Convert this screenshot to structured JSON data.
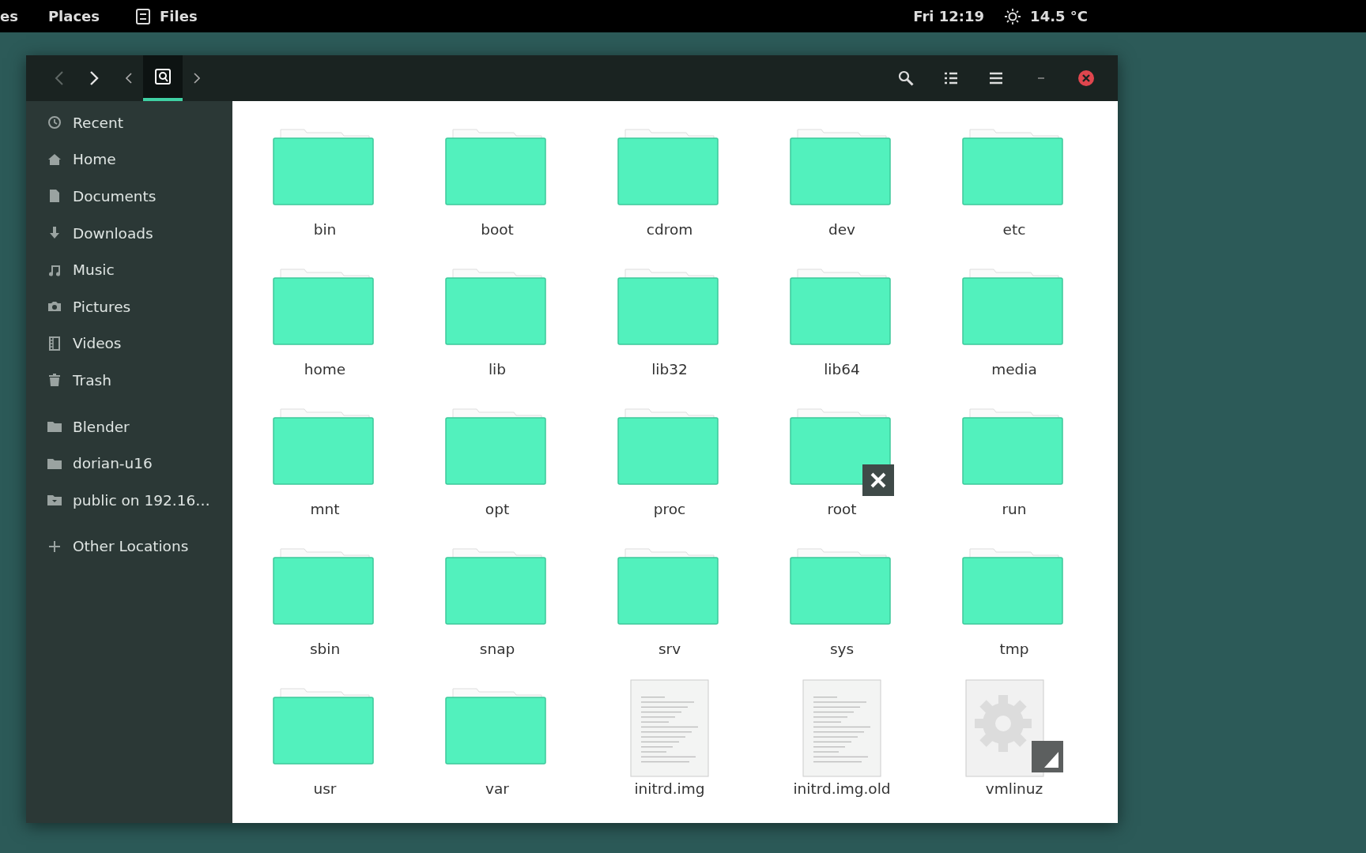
{
  "top_bar": {
    "activities": "es",
    "places": "Places",
    "app": "Files",
    "clock": "Fri 12:19",
    "weather": "14.5 °C"
  },
  "header": {
    "back_disabled": true,
    "forward_disabled": false,
    "path": [
      {
        "kind": "drive",
        "selected": true
      }
    ]
  },
  "sidebar": {
    "groups": [
      [
        {
          "label": "Recent"
        },
        {
          "label": "Home"
        },
        {
          "label": "Documents"
        },
        {
          "label": "Downloads"
        },
        {
          "label": "Music"
        },
        {
          "label": "Pictures"
        },
        {
          "label": "Videos"
        },
        {
          "label": "Trash"
        }
      ],
      [
        {
          "label": "Blender"
        },
        {
          "label": "dorian-u16"
        },
        {
          "label": "public on 192.16…"
        }
      ],
      [
        {
          "label": "Other Locations"
        }
      ]
    ]
  },
  "files": [
    {
      "name": "bin",
      "kind": "folder",
      "unreadable": false,
      "symlink": false
    },
    {
      "name": "boot",
      "kind": "folder",
      "unreadable": false,
      "symlink": false
    },
    {
      "name": "cdrom",
      "kind": "folder",
      "unreadable": false,
      "symlink": false
    },
    {
      "name": "dev",
      "kind": "folder",
      "unreadable": false,
      "symlink": false
    },
    {
      "name": "etc",
      "kind": "folder",
      "unreadable": false,
      "symlink": false
    },
    {
      "name": "home",
      "kind": "folder",
      "unreadable": false,
      "symlink": false
    },
    {
      "name": "lib",
      "kind": "folder",
      "unreadable": false,
      "symlink": false
    },
    {
      "name": "lib32",
      "kind": "folder",
      "unreadable": false,
      "symlink": false
    },
    {
      "name": "lib64",
      "kind": "folder",
      "unreadable": false,
      "symlink": false
    },
    {
      "name": "media",
      "kind": "folder",
      "unreadable": false,
      "symlink": false
    },
    {
      "name": "mnt",
      "kind": "folder",
      "unreadable": false,
      "symlink": false
    },
    {
      "name": "opt",
      "kind": "folder",
      "unreadable": false,
      "symlink": false
    },
    {
      "name": "proc",
      "kind": "folder",
      "unreadable": false,
      "symlink": false
    },
    {
      "name": "root",
      "kind": "folder",
      "unreadable": true,
      "symlink": false
    },
    {
      "name": "run",
      "kind": "folder",
      "unreadable": false,
      "symlink": false
    },
    {
      "name": "sbin",
      "kind": "folder",
      "unreadable": false,
      "symlink": false
    },
    {
      "name": "snap",
      "kind": "folder",
      "unreadable": false,
      "symlink": false
    },
    {
      "name": "srv",
      "kind": "folder",
      "unreadable": false,
      "symlink": false
    },
    {
      "name": "sys",
      "kind": "folder",
      "unreadable": false,
      "symlink": false
    },
    {
      "name": "tmp",
      "kind": "folder",
      "unreadable": false,
      "symlink": false
    },
    {
      "name": "usr",
      "kind": "folder",
      "unreadable": false,
      "symlink": false
    },
    {
      "name": "var",
      "kind": "folder",
      "unreadable": false,
      "symlink": false
    },
    {
      "name": "initrd.img",
      "kind": "text",
      "unreadable": false,
      "symlink": false
    },
    {
      "name": "initrd.img.old",
      "kind": "text",
      "unreadable": false,
      "symlink": false
    },
    {
      "name": "vmlinuz",
      "kind": "executable",
      "unreadable": false,
      "symlink": true
    }
  ]
}
